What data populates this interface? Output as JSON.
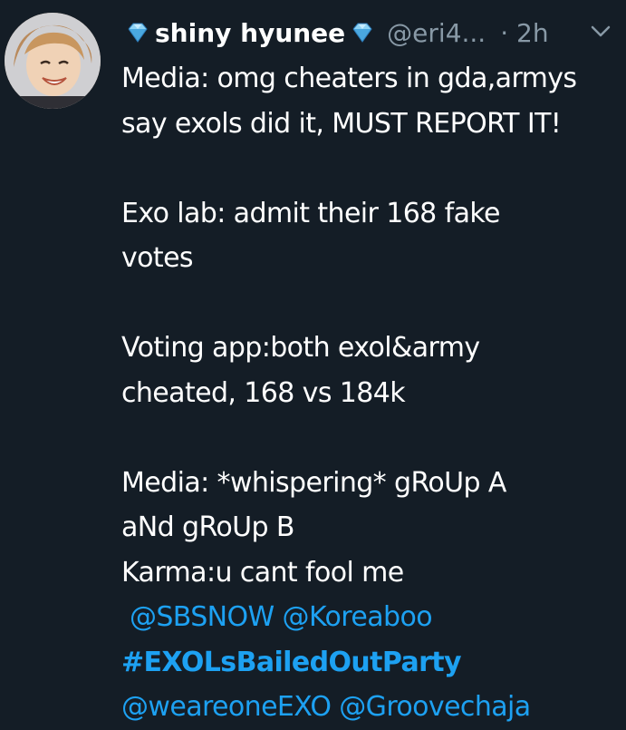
{
  "tweet": {
    "display_name": "shiny hyunee",
    "handle": "@eri4...",
    "separator": "·",
    "time": "2h",
    "icons": {
      "name_prefix": "diamond-emoji-icon",
      "name_suffix": "diamond-emoji-icon",
      "menu": "chevron-down-icon"
    },
    "colors": {
      "background": "#141d26",
      "text": "#ffffff",
      "muted": "#8899a6",
      "link": "#1da1f2"
    },
    "body": {
      "p1_line1": "Media: omg cheaters in gda,armys",
      "p1_line2": "say exols did it, MUST REPORT IT!",
      "p2_line1": "Exo lab: admit their 168 fake",
      "p2_line2": "votes",
      "p3_line1": "Voting app:both exol&army",
      "p3_line2": "cheated, 168 vs 184k",
      "p4_line1": "Media: *whispering* gRoUp A",
      "p4_line2": "aNd gRoUp B",
      "p4_line3": "Karma:u cant fool me",
      "mention_1": "@SBSNOW",
      "mention_2": "@Koreaboo",
      "hashtag": "#EXOLsBailedOutParty",
      "mention_3": "@weareoneEXO",
      "mention_4": "@Groovechaja"
    }
  }
}
